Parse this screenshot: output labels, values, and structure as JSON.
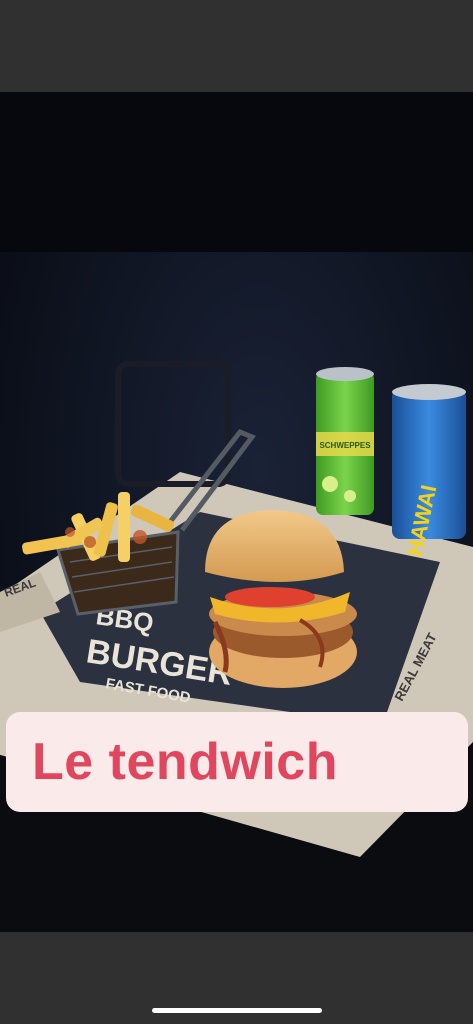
{
  "caption": {
    "text": "Le tendwich"
  },
  "tray_paper": {
    "line1": "BBQ",
    "line2": "BURGER",
    "line3": "FAST FOOD",
    "side_right": "REAL MEAT",
    "side_left": "REAL"
  },
  "can_left": {
    "brand": "SCHWEPPES",
    "color": "#5cbf3a"
  },
  "can_right": {
    "brand": "HAWAI",
    "color": "#2a72c8"
  },
  "colors": {
    "background": "#303030",
    "caption_bg": "#fbeaea",
    "caption_text": "#e0475e"
  }
}
